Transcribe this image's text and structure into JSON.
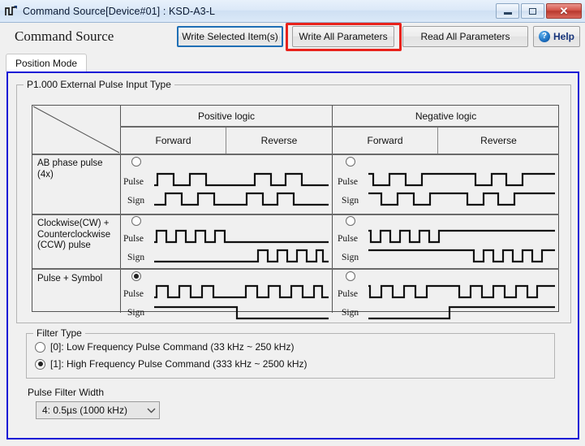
{
  "window": {
    "title": "Command Source[Device#01]  : KSD-A3-L",
    "icon": "waveform-icon",
    "minimize_label": "—",
    "maximize_label": "□",
    "close_label": "✕"
  },
  "header": {
    "page_title": "Command Source",
    "buttons": [
      {
        "id": "write-selected",
        "label": "Write Selected Item(s)",
        "border_color": "#1f6fb5"
      },
      {
        "id": "write-all",
        "label": "Write All Parameters",
        "highlight_color": "#e8231c"
      },
      {
        "id": "read-all",
        "label": "Read All Parameters"
      }
    ],
    "help": {
      "label": "Help",
      "icon": "question-mark-icon",
      "glyph": "?"
    }
  },
  "tabs": [
    {
      "label": "Position Mode",
      "active": true
    }
  ],
  "pulse_type_group": {
    "title": "P1.000 External Pulse Input Type",
    "top_headers": [
      "Positive logic",
      "Negative logic"
    ],
    "sub_headers": [
      "Forward",
      "Reverse",
      "Forward",
      "Reverse"
    ],
    "rows": [
      {
        "label": "AB phase pulse\n(4x)",
        "label_line1": "AB phase pulse",
        "label_line2": "(4x)",
        "positive_selected": false,
        "negative_selected": false,
        "wave_labels": [
          "Pulse",
          "Sign"
        ]
      },
      {
        "label": "Clockwise(CW) +\nCounterclockwise\n(CCW) pulse",
        "label_line1": "Clockwise(CW) +",
        "label_line2": "Counterclockwise",
        "label_line3": "(CCW) pulse",
        "positive_selected": false,
        "negative_selected": false,
        "wave_labels": [
          "Pulse",
          "Sign"
        ]
      },
      {
        "label": "Pulse + Symbol",
        "label_line1": "Pulse + Symbol",
        "positive_selected": true,
        "negative_selected": false,
        "wave_labels": [
          "Pulse",
          "Sign"
        ]
      }
    ]
  },
  "filter_type_group": {
    "title": "Filter Type",
    "options": [
      {
        "label": "[0]: Low Frequency Pulse Command (33 kHz ~ 250 kHz)",
        "selected": false
      },
      {
        "label": "[1]: High Frequency Pulse Command (333 kHz ~ 2500 kHz)",
        "selected": true
      }
    ]
  },
  "pulse_filter_width": {
    "label": "Pulse Filter Width",
    "value": "4: 0.5µs (1000 kHz)",
    "arrow": "⌄"
  },
  "colors": {
    "panel_border": "#1515d6",
    "accent_blue": "#1f6fb5",
    "highlight_red": "#e8231c",
    "window_bg": "#f0f0f0"
  }
}
